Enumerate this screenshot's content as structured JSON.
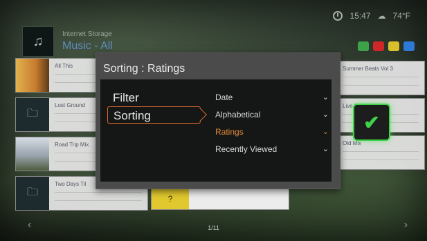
{
  "header": {
    "time": "15:47",
    "temperature": "74°F",
    "app_title": "Internet Storage",
    "app_sub": "Music - All",
    "color_keys": [
      "#3fa04a",
      "#d02828",
      "#d9c02a",
      "#2d7ad6"
    ]
  },
  "grid": {
    "tiles": [
      {
        "title": "All This"
      },
      {
        "title": "Lost Ground"
      },
      {
        "title": "Road Trip Mix"
      },
      {
        "title": "Two Days Til"
      },
      {
        "title": "Summer Beats Vol 3"
      },
      {
        "title": "Live Mix"
      },
      {
        "title": "Old Mix"
      }
    ],
    "pager": "1/11"
  },
  "dialog": {
    "title": "Sorting : Ratings",
    "left_menu": [
      "Filter",
      "Sorting"
    ],
    "selected_left": "Sorting",
    "options": [
      "Date",
      "Alphabetical",
      "Ratings",
      "Recently Viewed"
    ],
    "active_option": "Ratings",
    "chevron": "⌄"
  },
  "confirm": {
    "icon": "checkmark-icon",
    "symbol": "✔"
  },
  "icons": {
    "music": "♫",
    "folder": "🗀",
    "left": "‹",
    "right": "›",
    "clock": "clock-icon",
    "weather": "weather-icon"
  }
}
